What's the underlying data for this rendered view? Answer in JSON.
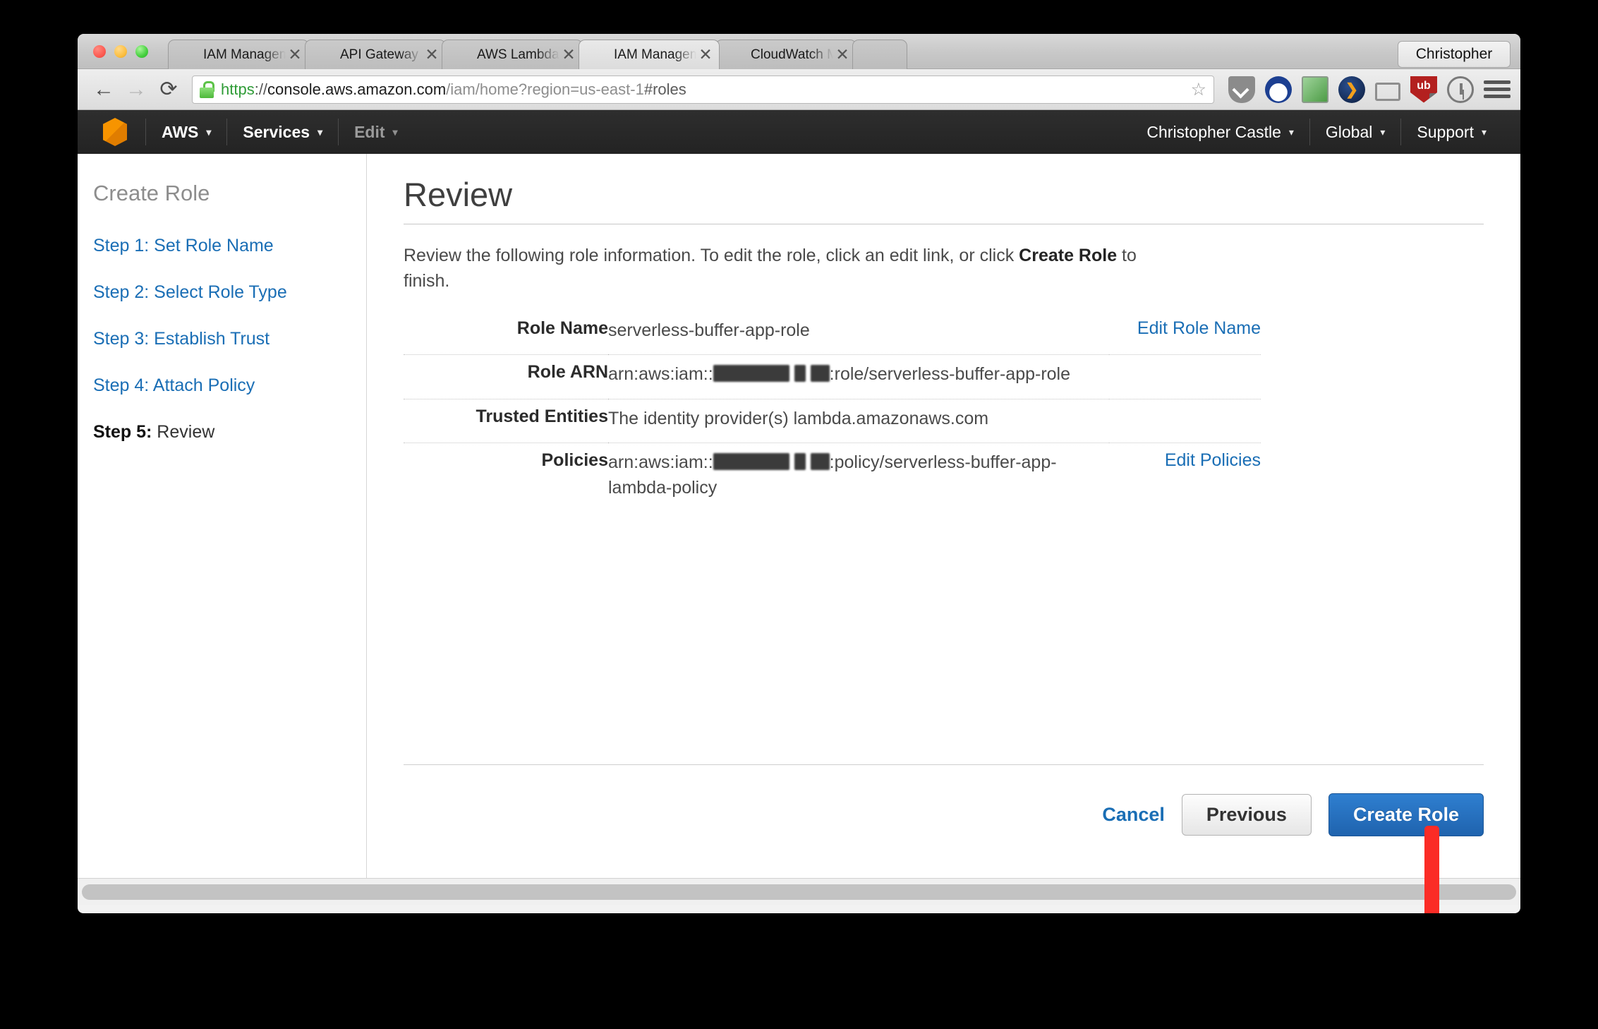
{
  "browser": {
    "tabs": [
      {
        "title": "IAM Management Console",
        "favicon": "aws-cube-icon",
        "active": false
      },
      {
        "title": "API Gateway",
        "favicon": "aws-cube-icon",
        "active": false
      },
      {
        "title": "AWS Lambda",
        "favicon": "aws-lambda-icon",
        "active": false
      },
      {
        "title": "IAM Management Console",
        "favicon": "aws-cube-icon",
        "active": true
      },
      {
        "title": "CloudWatch Management Console",
        "favicon": "aws-cube-icon",
        "active": false
      }
    ],
    "tab_close_label": "✕",
    "profile_name": "Christopher",
    "nav": {
      "back_label": "←",
      "forward_label": "→",
      "reload_label": "⟳",
      "star_label": "☆"
    },
    "url": {
      "scheme": "https",
      "separator": "://",
      "host": "console.aws.amazon.com",
      "path": "/iam/home?region=us-east-1",
      "fragment": "#roles",
      "full": "https://console.aws.amazon.com/iam/home?region=us-east-1#roles"
    },
    "extensions": [
      {
        "name": "pocket-icon"
      },
      {
        "name": "cloud-icon"
      },
      {
        "name": "remote-window-icon"
      },
      {
        "name": "speed-dial-icon"
      },
      {
        "name": "cast-icon"
      },
      {
        "name": "ublock-origin-icon",
        "badge": "1"
      },
      {
        "name": "1password-icon"
      },
      {
        "name": "hamburger-menu-icon"
      }
    ]
  },
  "aws_nav": {
    "logo": "aws-cube-logo",
    "left_items": [
      {
        "label": "AWS",
        "caret": true,
        "muted": false
      },
      {
        "label": "Services",
        "caret": true,
        "muted": false
      },
      {
        "label": "Edit",
        "caret": true,
        "muted": true
      }
    ],
    "right_items": [
      {
        "label": "Christopher Castle",
        "caret": true
      },
      {
        "label": "Global",
        "caret": true
      },
      {
        "label": "Support",
        "caret": true
      }
    ],
    "caret_glyph": "▾"
  },
  "sidebar": {
    "title": "Create Role",
    "steps": [
      {
        "prefix": "Step 1:",
        "label": " Set Role Name",
        "current": false
      },
      {
        "prefix": "Step 2:",
        "label": " Select Role Type",
        "current": false
      },
      {
        "prefix": "Step 3:",
        "label": " Establish Trust",
        "current": false
      },
      {
        "prefix": "Step 4:",
        "label": " Attach Policy",
        "current": false
      },
      {
        "prefix": "Step 5:",
        "label": " Review",
        "current": true
      }
    ]
  },
  "content": {
    "page_title": "Review",
    "intro_part1": "Review the following role information. To edit the role, click an edit link, or click ",
    "intro_bold": "Create Role",
    "intro_part2": " to finish.",
    "rows": [
      {
        "label": "Role Name",
        "value": "serverless-buffer-app-role",
        "action": "Edit Role Name",
        "redacted": false
      },
      {
        "label": "Role ARN",
        "value_prefix": "arn:aws:iam::",
        "value_suffix": ":role/serverless-buffer-app-role",
        "action": "",
        "redacted": true
      },
      {
        "label": "Trusted Entities",
        "value": "The identity provider(s) lambda.amazonaws.com",
        "action": "",
        "redacted": false
      },
      {
        "label": "Policies",
        "value_prefix": "arn:aws:iam::",
        "value_suffix": ":policy/serverless-buffer-app-lambda-policy",
        "action": "Edit Policies",
        "redacted": true
      }
    ],
    "actions": {
      "cancel": "Cancel",
      "previous": "Previous",
      "create": "Create Role"
    }
  },
  "annotation": {
    "arrow": "red-down-arrow",
    "color": "#fb2c26"
  },
  "colors": {
    "link_blue": "#1a6eb5",
    "primary_button": "#1f63ae",
    "aws_orange": "#f79400",
    "nav_dark": "#232323"
  }
}
